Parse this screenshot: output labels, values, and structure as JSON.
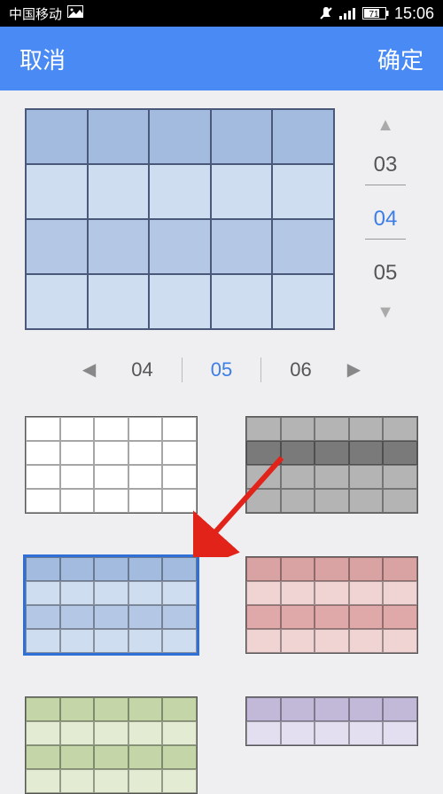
{
  "status": {
    "carrier": "中国移动",
    "battery": "71",
    "time": "15:06"
  },
  "header": {
    "cancel": "取消",
    "confirm": "确定"
  },
  "preview": {
    "big_grid_rows": 4,
    "big_grid_cols": 5,
    "big_grid_row_colors": [
      "#a2bbdf",
      "#cfddf0",
      "#b4c8e5",
      "#cfddf0"
    ],
    "vertical_picker": {
      "prev": "03",
      "sel": "04",
      "next": "05"
    },
    "horizontal_picker": {
      "prev": "04",
      "sel": "05",
      "next": "06"
    }
  },
  "themes": [
    {
      "id": "white",
      "row_colors": [
        "#ffffff",
        "#ffffff",
        "#ffffff",
        "#ffffff"
      ],
      "border": "#555",
      "selected": false
    },
    {
      "id": "gray",
      "row_colors": [
        "#b4b4b4",
        "#7a7a7a",
        "#b4b4b4",
        "#b4b4b4"
      ],
      "border": "#555",
      "selected": false
    },
    {
      "id": "blue",
      "row_colors": [
        "#a2bbdf",
        "#cfddf0",
        "#b4c8e5",
        "#cfddf0"
      ],
      "border": "#2f6fd6",
      "selected": true
    },
    {
      "id": "red",
      "row_colors": [
        "#d9a3a3",
        "#f0d4d4",
        "#dfa9a9",
        "#f0d4d4"
      ],
      "border": "#555",
      "selected": false
    },
    {
      "id": "green",
      "row_colors": [
        "#c4d6a8",
        "#e3ebd2",
        "#c4d6a8",
        "#e3ebd2"
      ],
      "border": "#555",
      "selected": false
    },
    {
      "id": "purple",
      "row_colors": [
        "#c2b9d8",
        "#e3def0"
      ],
      "border": "#555",
      "selected": false,
      "partial": true
    }
  ],
  "icons": {
    "image": "image-icon",
    "mute": "mute-icon",
    "signal": "signal-icon",
    "battery": "battery-icon",
    "up": "▲",
    "down": "▼",
    "left": "◀",
    "right": "▶"
  }
}
